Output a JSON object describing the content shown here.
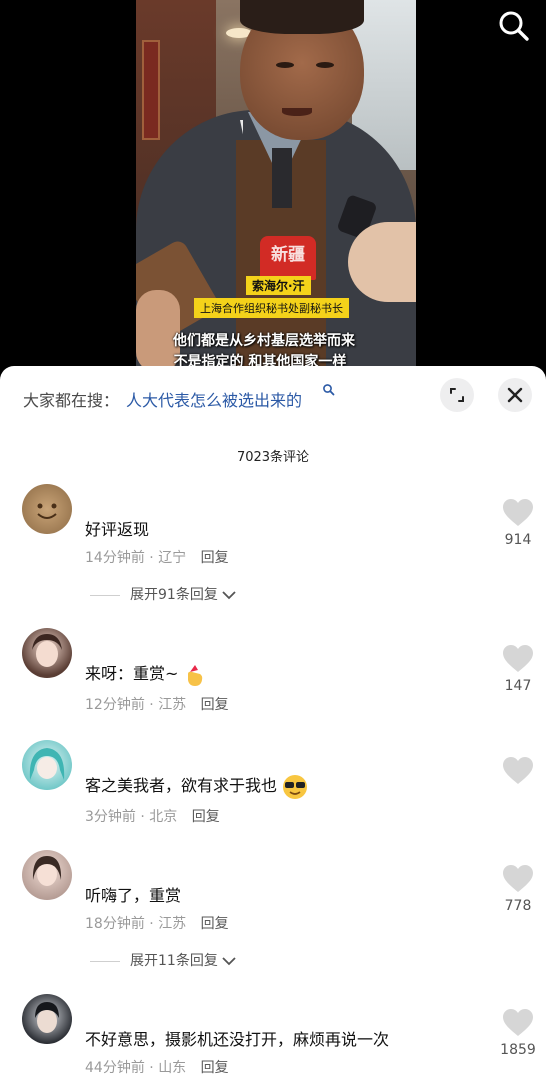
{
  "video": {
    "mic_logo": "新疆",
    "name_card": "索海尔·汗",
    "title_card": "上海合作组织秘书处副秘书长",
    "subtitle_line1": "他们都是从乡村基层选举而来",
    "subtitle_line2": "不是指定的 和其他国家一样"
  },
  "search_bar": {
    "prefix": "大家都在搜：",
    "query": "人大代表怎么被选出来的"
  },
  "comment_count": "7023条评论",
  "comments": [
    {
      "text": "好评返现",
      "time": "14分钟前",
      "location": "辽宁",
      "reply": "回复",
      "likes": "914",
      "expand": "展开91条回复"
    },
    {
      "text": "来呀：重赏~",
      "time": "12分钟前",
      "location": "江苏",
      "reply": "回复",
      "likes": "147",
      "emoji": "hand-heart"
    },
    {
      "text": "客之美我者，欲有求于我也",
      "time": "3分钟前",
      "location": "北京",
      "reply": "回复",
      "likes": "",
      "emoji": "sunglasses"
    },
    {
      "text": "听嗨了，重赏",
      "time": "18分钟前",
      "location": "江苏",
      "reply": "回复",
      "likes": "778",
      "expand": "展开11条回复"
    },
    {
      "text": "不好意思，摄影机还没打开，麻烦再说一次",
      "time": "44分钟前",
      "location": "山东",
      "reply": "回复",
      "likes": "1859"
    }
  ],
  "colors": {
    "query_blue": "#2c5aa6",
    "meta_gray": "#9a9a9a",
    "heart_gray": "#d6d6d6",
    "tag_yellow": "#f4d21a"
  }
}
